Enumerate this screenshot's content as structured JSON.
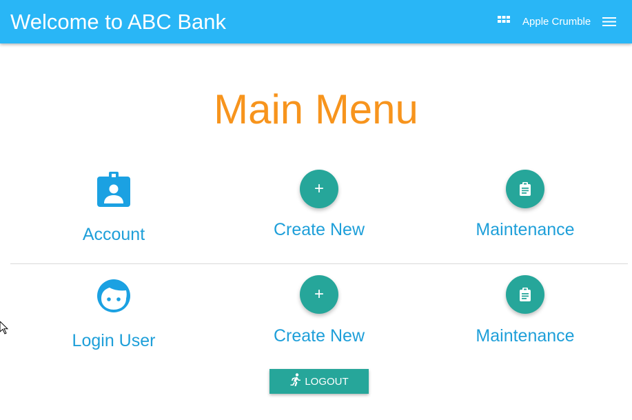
{
  "header": {
    "title": "Welcome to ABC Bank",
    "user_name": "Apple Crumble",
    "apps_icon": "apps-grid-icon",
    "menu_icon": "hamburger-menu-icon",
    "background_color": "#29b6f6"
  },
  "main": {
    "title": "Main Menu",
    "title_color": "#f7941d"
  },
  "rows": [
    {
      "section_label": "Account",
      "section_icon": "account-badge-icon",
      "create_label": "Create New",
      "create_icon": "plus-icon",
      "create_symbol": "+",
      "maintenance_label": "Maintenance",
      "maintenance_icon": "clipboard-icon"
    },
    {
      "section_label": "Login User",
      "section_icon": "face-icon",
      "create_label": "Create New",
      "create_icon": "plus-icon",
      "create_symbol": "+",
      "maintenance_label": "Maintenance",
      "maintenance_icon": "clipboard-icon"
    }
  ],
  "logout": {
    "label": "LOGOUT",
    "icon": "running-person-icon"
  },
  "colors": {
    "accent_teal": "#26a69a",
    "link_blue": "#1e9fd9",
    "icon_blue": "#1ba1e2"
  }
}
